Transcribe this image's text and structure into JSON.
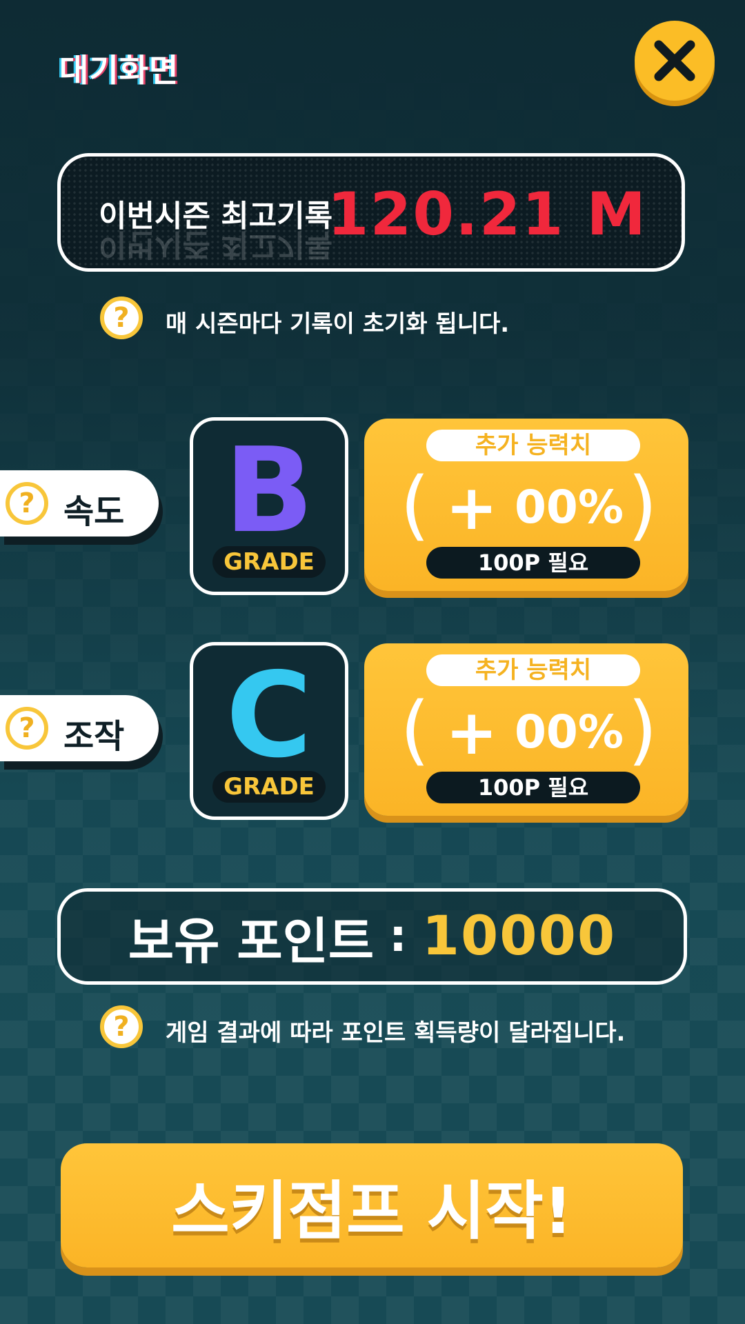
{
  "header": {
    "title": "대기화면",
    "close_icon": "close-icon"
  },
  "record": {
    "label": "이번시즌 최고기록",
    "value": "120.21 M",
    "value_color": "#f0283c"
  },
  "record_note": "매 시즌마다 기록이 초기화 됩니다.",
  "stats": [
    {
      "label": "속도",
      "grade": "B",
      "grade_color": "#7b5cf5",
      "grade_tag": "GRADE",
      "upgrade_title": "추가 능력치",
      "upgrade_value": "00%",
      "upgrade_cost": "100P 필요"
    },
    {
      "label": "조작",
      "grade": "C",
      "grade_color": "#35c8f0",
      "grade_tag": "GRADE",
      "upgrade_title": "추가 능력치",
      "upgrade_value": "00%",
      "upgrade_cost": "100P 필요"
    }
  ],
  "points": {
    "label": "보유 포인트",
    "separator": ":",
    "value": "10000"
  },
  "points_note": "게임 결과에 따라 포인트 획득량이 달라집니다.",
  "start_button": {
    "label": "스키점프 시작!"
  },
  "help_icon_glyph": "?",
  "colors": {
    "accent": "#fbbd26",
    "background": "#174a55"
  }
}
